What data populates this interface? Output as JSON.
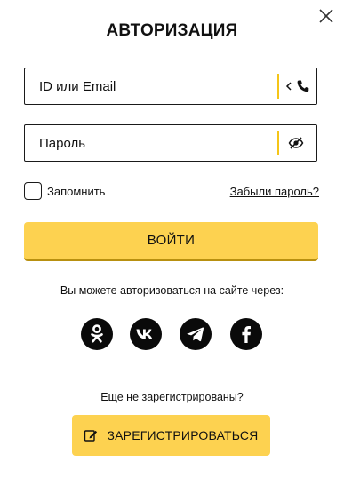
{
  "dialog": {
    "title": "АВТОРИЗАЦИЯ",
    "close_icon": "close-icon"
  },
  "login_field": {
    "placeholder": "ID или Email",
    "icons": [
      "chevron-left-icon",
      "phone-icon"
    ]
  },
  "password_field": {
    "placeholder": "Пароль",
    "icons": [
      "eye-off-icon"
    ]
  },
  "remember": {
    "label": "Запомнить",
    "checked": false
  },
  "forgot_link": "Забыли пароль?",
  "login_button": "ВОЙТИ",
  "social_prompt": "Вы можете авторизоваться на сайте через:",
  "socials": [
    "odnoklassniki-icon",
    "vk-icon",
    "telegram-icon",
    "facebook-icon"
  ],
  "register_prompt": "Еще не зарегистрированы?",
  "register_button": "ЗАРЕГИСТРИРОВАТЬСЯ",
  "colors": {
    "accent": "#fdd250",
    "accent_shadow": "#b8900f",
    "separator": "#f5c518",
    "text": "#111111"
  }
}
